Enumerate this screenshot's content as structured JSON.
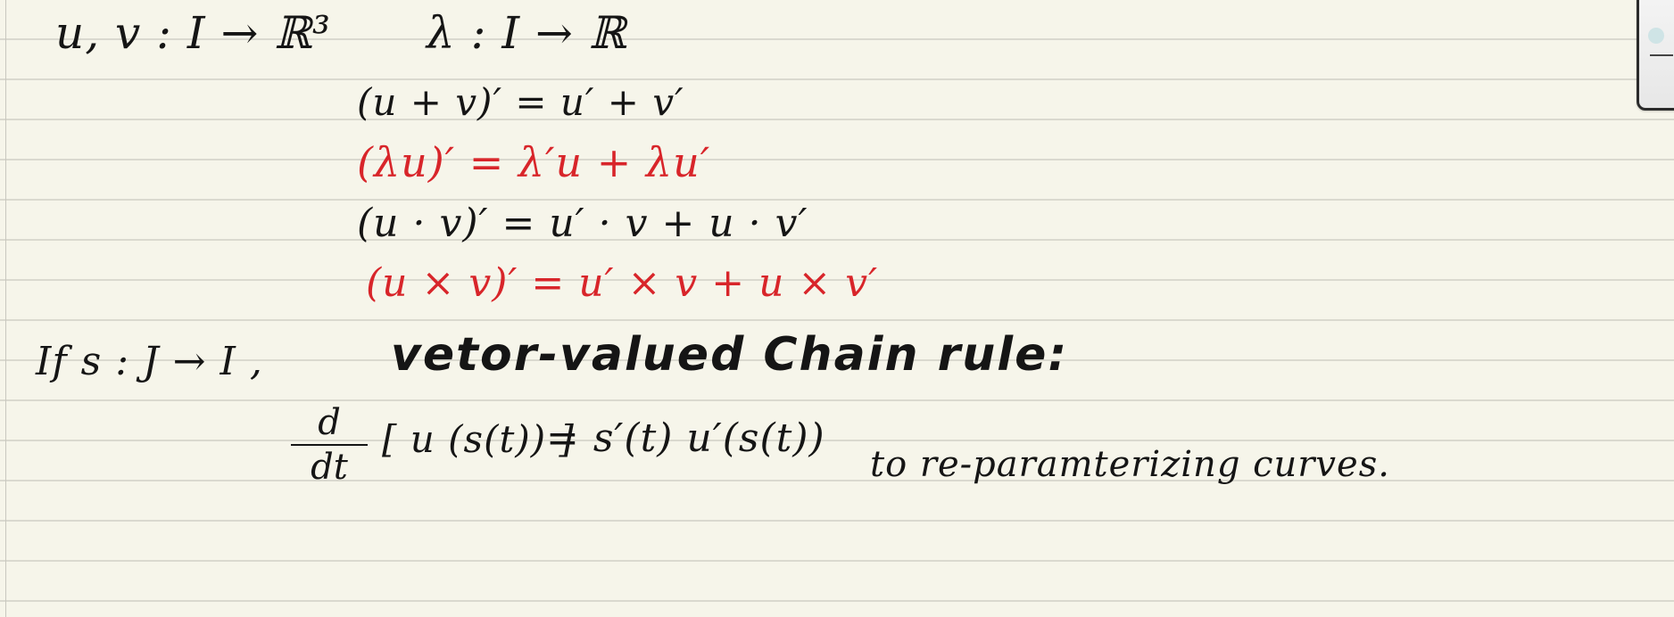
{
  "notes": {
    "line1_vectors": "u, v : I → ℝ³",
    "line1_scalar": "λ : I → ℝ",
    "rule_sum": "(u + v)′ = u′ + v′",
    "rule_scalar_mult": "(λu)′ = λ′u + λu′",
    "rule_dot": "(u · v)′ = u′ · v + u · v′",
    "rule_cross": "(u × v)′ = u′ × v + u × v′",
    "chain_condition": "If   s : J → I ,",
    "chain_title": "vetor-valued Chain rule:",
    "deriv_num": "d",
    "deriv_den": "dt",
    "chain_lhs": "[ u (s(t)) ]",
    "chain_rhs": "= s′(t) u′(s(t))",
    "side_note": "to re-paramterizing curves."
  },
  "colors": {
    "ink": "#151515",
    "red_ink": "#d8252a",
    "paper": "#f6f5ea",
    "rule": "#dad9cf"
  }
}
